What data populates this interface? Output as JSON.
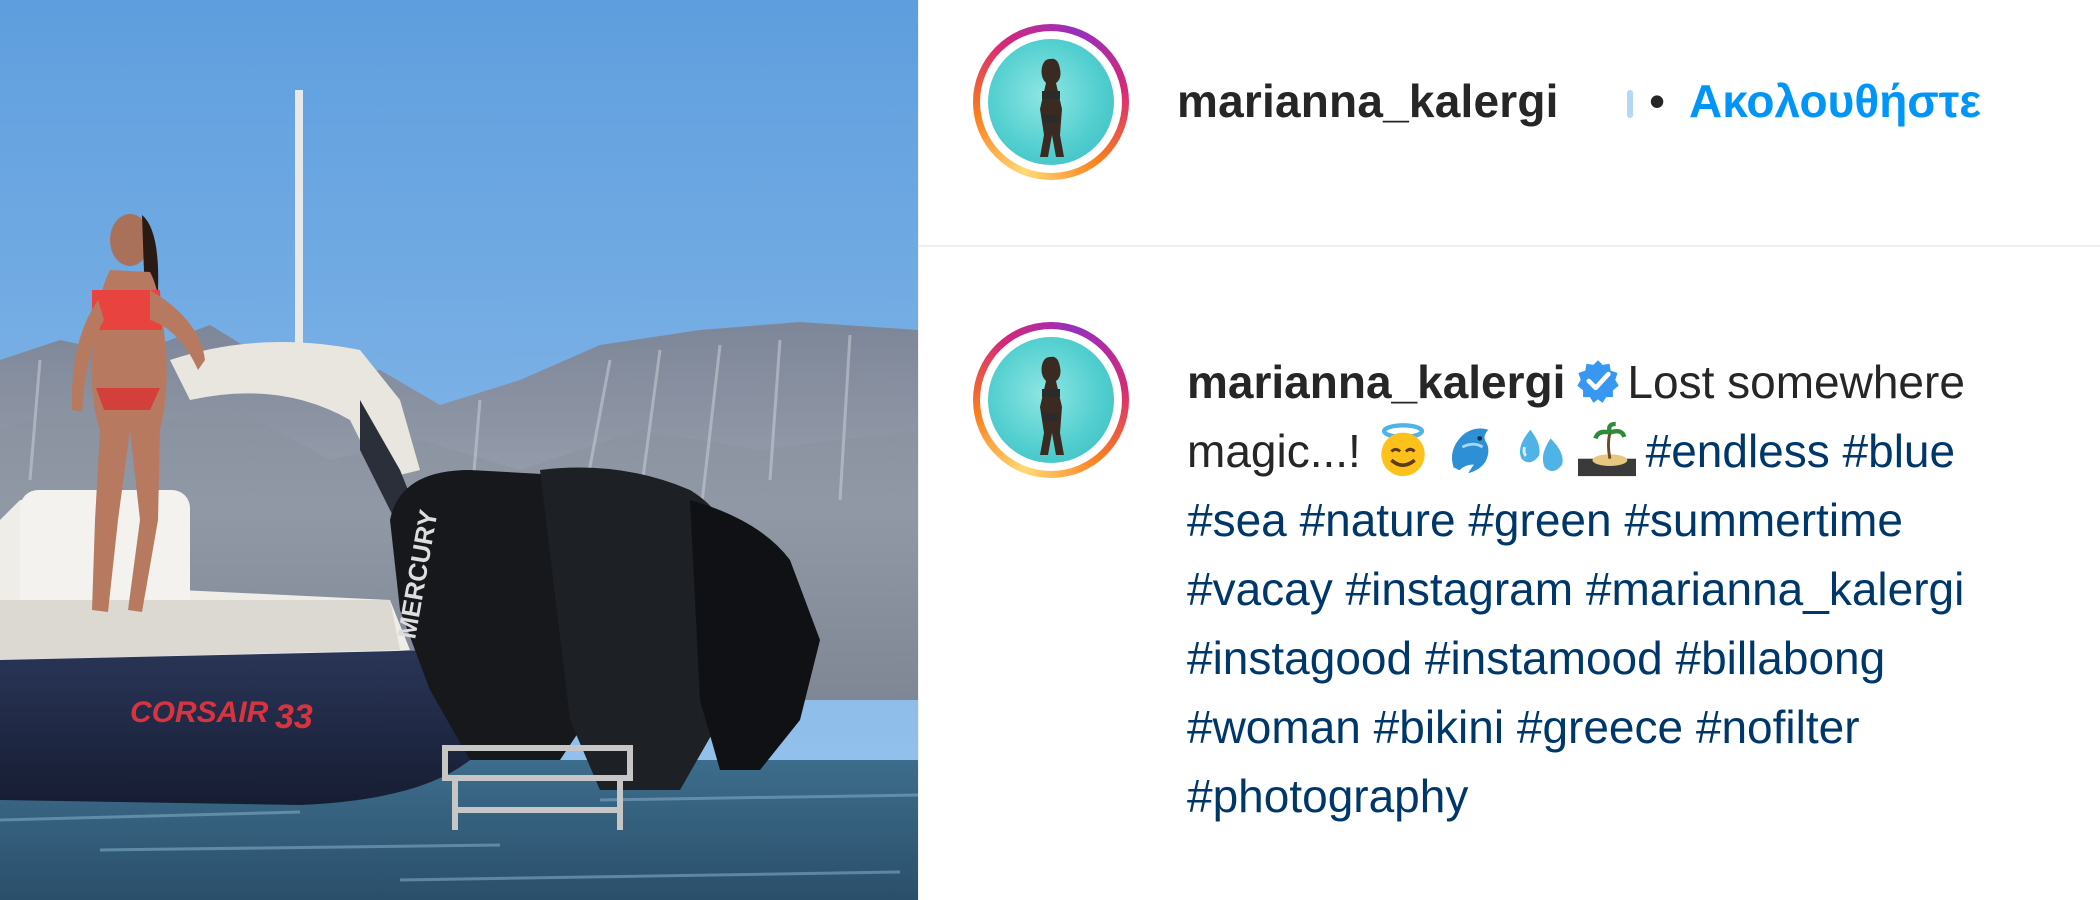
{
  "photo": {
    "alt_subject": "boat-photo",
    "boat_brand": "CORSAIR",
    "boat_model": "33",
    "engine_brand": "MERCURY"
  },
  "header": {
    "username": "marianna_kalergi",
    "separator": "•",
    "follow_label": "Ακολουθήστε"
  },
  "caption": {
    "username": "marianna_kalergi",
    "text_line1": "Lost somewhere",
    "text_line2": "magic...!",
    "emojis": [
      "smiling-face-with-halo-icon",
      "dolphin-icon",
      "sweat-droplets-icon",
      "desert-island-icon"
    ],
    "hashtags_line2": [
      "#endless",
      "#blue"
    ],
    "hashtags_line3": [
      "#sea",
      "#nature",
      "#green",
      "#summertime"
    ],
    "hashtags_line4": [
      "#vacay",
      "#instagram",
      "#marianna_kalergi"
    ],
    "hashtags_line5": [
      "#instagood",
      "#instamood",
      "#billabong"
    ],
    "hashtags_line6": [
      "#woman",
      "#bikini",
      "#greece",
      "#nofilter"
    ],
    "hashtags_line7": [
      "#photography"
    ]
  },
  "colors": {
    "link_blue": "#0095f6",
    "hashtag": "#00376b",
    "text": "#262626",
    "verified": "#3897f0"
  }
}
